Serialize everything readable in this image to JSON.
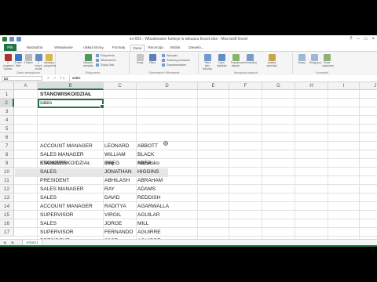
{
  "window": {
    "title": "ex-003 - Wbudowane funkcje w arkuszu Excel.xlsx - Microsoft Excel",
    "controls": [
      "?",
      "–",
      "□",
      "×"
    ]
  },
  "ribbon": {
    "file_tab": "Plik",
    "tabs": [
      "Narzędzia główne",
      "Wstawianie",
      "Układ strony",
      "Formuły",
      "Dane",
      "Recenzja",
      "Widok",
      "Dewelo..."
    ],
    "active_tab": "Dane",
    "groups": [
      {
        "label": "Dane zewnętrzne",
        "buttons": [
          "Z programu Access",
          "Z sieci Web",
          "Z tekstu",
          "Z innych źródeł",
          "Istniejące połączenia"
        ]
      },
      {
        "label": "Połączenia",
        "small": [
          "Połączenia",
          "Właściwości",
          "Edytuj linki"
        ],
        "buttons": [
          "Odśwież wszystko"
        ]
      },
      {
        "label": "Sortowanie i filtrowanie",
        "buttons": [
          "Sortuj",
          "Filtruj"
        ],
        "small": [
          "Wyczyść",
          "Zastosuj ponownie",
          "Zaawansowane"
        ]
      },
      {
        "label": "Narzędzia danych",
        "buttons": [
          "Tekst jako kolumny",
          "Usuń duplikaty",
          "Poprawność danych",
          "Konsoliduj",
          "Analiza symulacji"
        ]
      },
      {
        "label": "Konspekt",
        "buttons": [
          "Grupuj",
          "Rozgrupuj",
          "Suma częściowa"
        ]
      }
    ]
  },
  "formula_bar": {
    "name_box": "B2",
    "fx": "× ✓ fx",
    "value": "sales"
  },
  "sheet": {
    "columns": [
      "A",
      "B",
      "C",
      "D",
      "E",
      "F",
      "G",
      "H",
      "I",
      "J",
      "K"
    ],
    "selected_column": "B",
    "rows": [
      "1",
      "2",
      "3",
      "4",
      "5",
      "6",
      "7",
      "8",
      "9",
      "10",
      "11",
      "12",
      "13",
      "14",
      "15",
      "16",
      "17"
    ],
    "selected_row": "2",
    "criteria_header": "STANOWISKO/DZIAŁ",
    "criteria_value": "sales",
    "table_headers": [
      "STANOWISKO/DZIAŁ",
      "Imię",
      "Nazwisko"
    ],
    "table_rows": [
      [
        "ACCOUNT MANAGER",
        "LEONARD",
        "ABBOTT"
      ],
      [
        "SALES MANAGER",
        "WILLIAM",
        "BLACK"
      ],
      [
        "ENGINEER",
        "GREG",
        "ABER"
      ],
      [
        "SALES",
        "JONATHAN",
        "HIGGINS"
      ],
      [
        "PRESIDENT",
        "ABHILASH",
        "ABRAHAM"
      ],
      [
        "SALES MANAGER",
        "RAY",
        "ADAMS"
      ],
      [
        " SALES",
        "DAVID",
        "REDDISH"
      ],
      [
        "ACCOUNT MANAGER",
        "RADITYA",
        "AGARWALLA"
      ],
      [
        "SUPERVISOR",
        "VIRGIL",
        "AGUILAR"
      ],
      [
        "SALES",
        "JORGE",
        "MILL"
      ],
      [
        "SUPERVISOR",
        "FERNANDO",
        "AGUIRRE"
      ],
      [
        " PRESIDENT",
        "JOSE",
        "AGUIRRE"
      ]
    ]
  },
  "sheet_tabs": {
    "nav": "◀ ▶",
    "active": "Arkusz1"
  },
  "colors": {
    "accent": "#217346",
    "header_band": "#e6e6e6"
  }
}
